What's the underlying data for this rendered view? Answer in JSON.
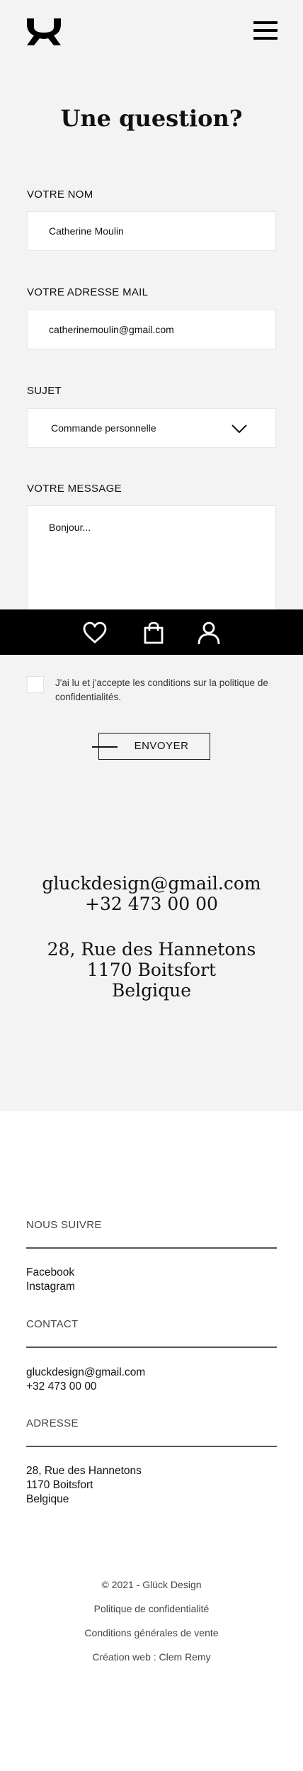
{
  "header": {
    "logo": "gluck-logo",
    "menu_icon": "hamburger-icon"
  },
  "title": "Une question?",
  "form": {
    "name": {
      "label": "VOTRE NOM",
      "value": "Catherine Moulin"
    },
    "email": {
      "label": "VOTRE ADRESSE MAIL",
      "value": "catherinemoulin@gmail.com"
    },
    "subject": {
      "label": "SUJET",
      "value": "Commande personnelle"
    },
    "message": {
      "label": "VOTRE MESSAGE",
      "value": "Bonjour..."
    },
    "consent": "J'ai lu et j'accepte les conditions sur la politique de confidentialités.",
    "send": "ENVOYER"
  },
  "bottom_nav": {
    "icons": [
      "heart-icon",
      "bag-icon",
      "user-icon"
    ]
  },
  "contact": {
    "email": "gluckdesign@gmail.com",
    "phone": "+32 473 00 00",
    "address": [
      "28, Rue des Hannetons",
      "1170 Boitsfort",
      "Belgique"
    ]
  },
  "footer": {
    "follow": {
      "title": "NOUS SUIVRE",
      "links": [
        "Facebook",
        "Instagram"
      ]
    },
    "contact": {
      "title": "CONTACT",
      "lines": [
        "gluckdesign@gmail.com",
        "+32 473 00 00"
      ]
    },
    "address": {
      "title": "ADRESSE",
      "lines": [
        "28, Rue des Hannetons",
        "1170 Boitsfort",
        "Belgique"
      ]
    },
    "legal": {
      "copyright": "© 2021 - Glück Design",
      "privacy": "Politique de confidentialité",
      "terms": "Conditions générales de vente",
      "credit": "Création web : Clem Remy"
    }
  },
  "colors": {
    "background": "#f3f3f3",
    "bar": "#000000",
    "text": "#111111"
  }
}
